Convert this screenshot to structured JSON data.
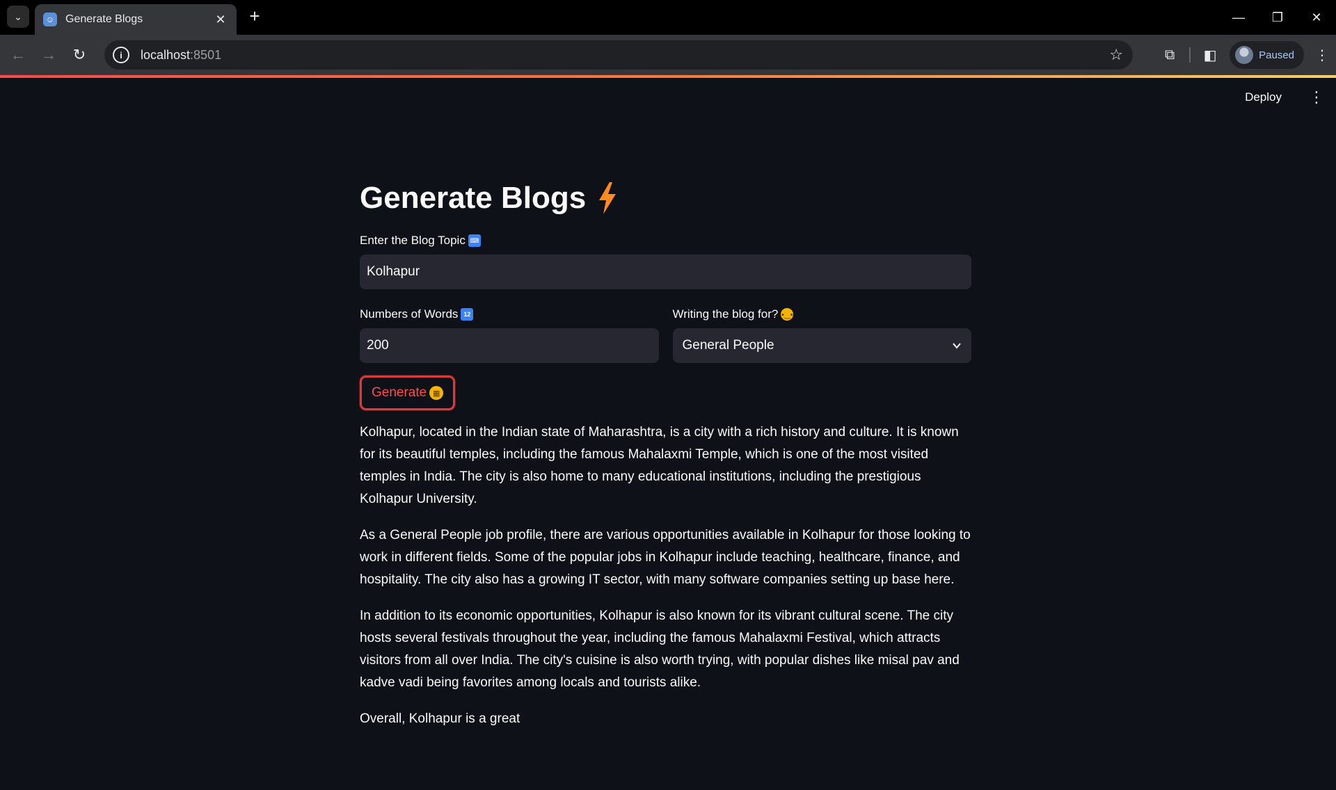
{
  "browser": {
    "tab_title": "Generate Blogs",
    "url_host": "localhost",
    "url_port": ":8501",
    "profile_label": "Paused"
  },
  "app": {
    "deploy_label": "Deploy",
    "title": "Generate Blogs",
    "topic": {
      "label": "Enter the Blog Topic",
      "value": "Kolhapur"
    },
    "words": {
      "label": "Numbers of Words",
      "value": "200"
    },
    "audience": {
      "label": "Writing the blog for?",
      "selected": "General People"
    },
    "generate_label": "Generate",
    "output_paragraphs": [
      "Kolhapur, located in the Indian state of Maharashtra, is a city with a rich history and culture. It is known for its beautiful temples, including the famous Mahalaxmi Temple, which is one of the most visited temples in India. The city is also home to many educational institutions, including the prestigious Kolhapur University.",
      "As a General People job profile, there are various opportunities available in Kolhapur for those looking to work in different fields. Some of the popular jobs in Kolhapur include teaching, healthcare, finance, and hospitality. The city also has a growing IT sector, with many software companies setting up base here.",
      "In addition to its economic opportunities, Kolhapur is also known for its vibrant cultural scene. The city hosts several festivals throughout the year, including the famous Mahalaxmi Festival, which attracts visitors from all over India. The city's cuisine is also worth trying, with popular dishes like misal pav and kadve vadi being favorites among locals and tourists alike.",
      "Overall, Kolhapur is a great"
    ]
  },
  "colors": {
    "background": "#0e1117",
    "input_bg": "#262730",
    "accent": "#ff4b4b",
    "bolt": "#ff8a1f"
  },
  "icons": [
    "tab-search-icon",
    "favicon-robot-icon",
    "close-icon",
    "plus-icon",
    "minimize-icon",
    "restore-icon",
    "back-icon",
    "forward-icon",
    "reload-icon",
    "info-icon",
    "star-icon",
    "extensions-icon",
    "sidepanel-icon",
    "more-icon",
    "bolt-icon",
    "keyboard-icon",
    "thinking-face-icon",
    "grimace-face-icon",
    "chevron-down-icon"
  ]
}
